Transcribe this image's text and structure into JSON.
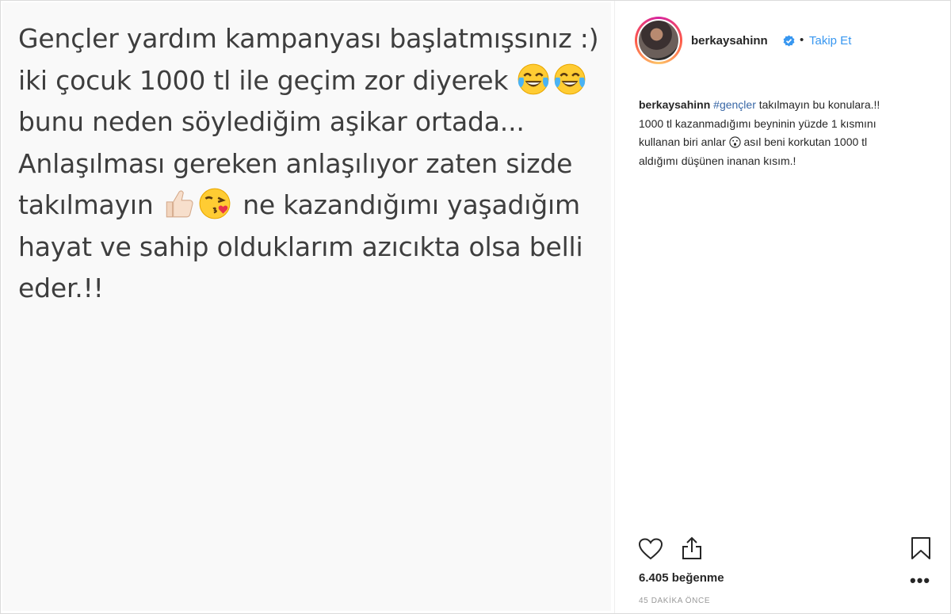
{
  "post_image": {
    "lines": [
      "Gençler yardım kampanyası başlatmışsınız :)",
      "iki çocuk 1000 tl ile geçim zor diyerek",
      "bunu neden söylediğim aşikar ortada...",
      "Anlaşılması gereken anlaşılıyor zaten sizde",
      "takılmayın",
      "ne kazandığımı yaşadığım",
      "hayat ve sahip olduklarım azıcıkta olsa belli",
      "eder.!!"
    ],
    "emojis": [
      "tears-of-joy-emoji",
      "tears-of-joy-emoji",
      "thumbs-up-emoji",
      "kissing-heart-emoji"
    ]
  },
  "header": {
    "username": "berkaysahinn",
    "separator": "•",
    "follow_label": "Takip Et"
  },
  "caption": {
    "username": "berkaysahinn",
    "hashtag": "#gençler",
    "text_part1": " takılmayın bu konulara.!! 1000 tl kazanmadığımı beyninin yüzde 1 kısmını kullanan biri anlar",
    "text_part2": " asıl beni korkutan 1000 tl aldığımı düşünen inanan kısım.!",
    "emoji": "surprised-face-emoji"
  },
  "actions": {
    "icons": [
      "heart-icon",
      "share-icon",
      "bookmark-icon",
      "more-icon"
    ]
  },
  "likes_text": "6.405 beğenme",
  "more_label": "•••",
  "timestamp": "45 DAKİKA ÖNCE",
  "colors": {
    "accent": "#3897f0",
    "text": "#262626",
    "muted": "#999999",
    "image_bg": "#f9f9f9",
    "image_text": "#3e3e3e"
  }
}
